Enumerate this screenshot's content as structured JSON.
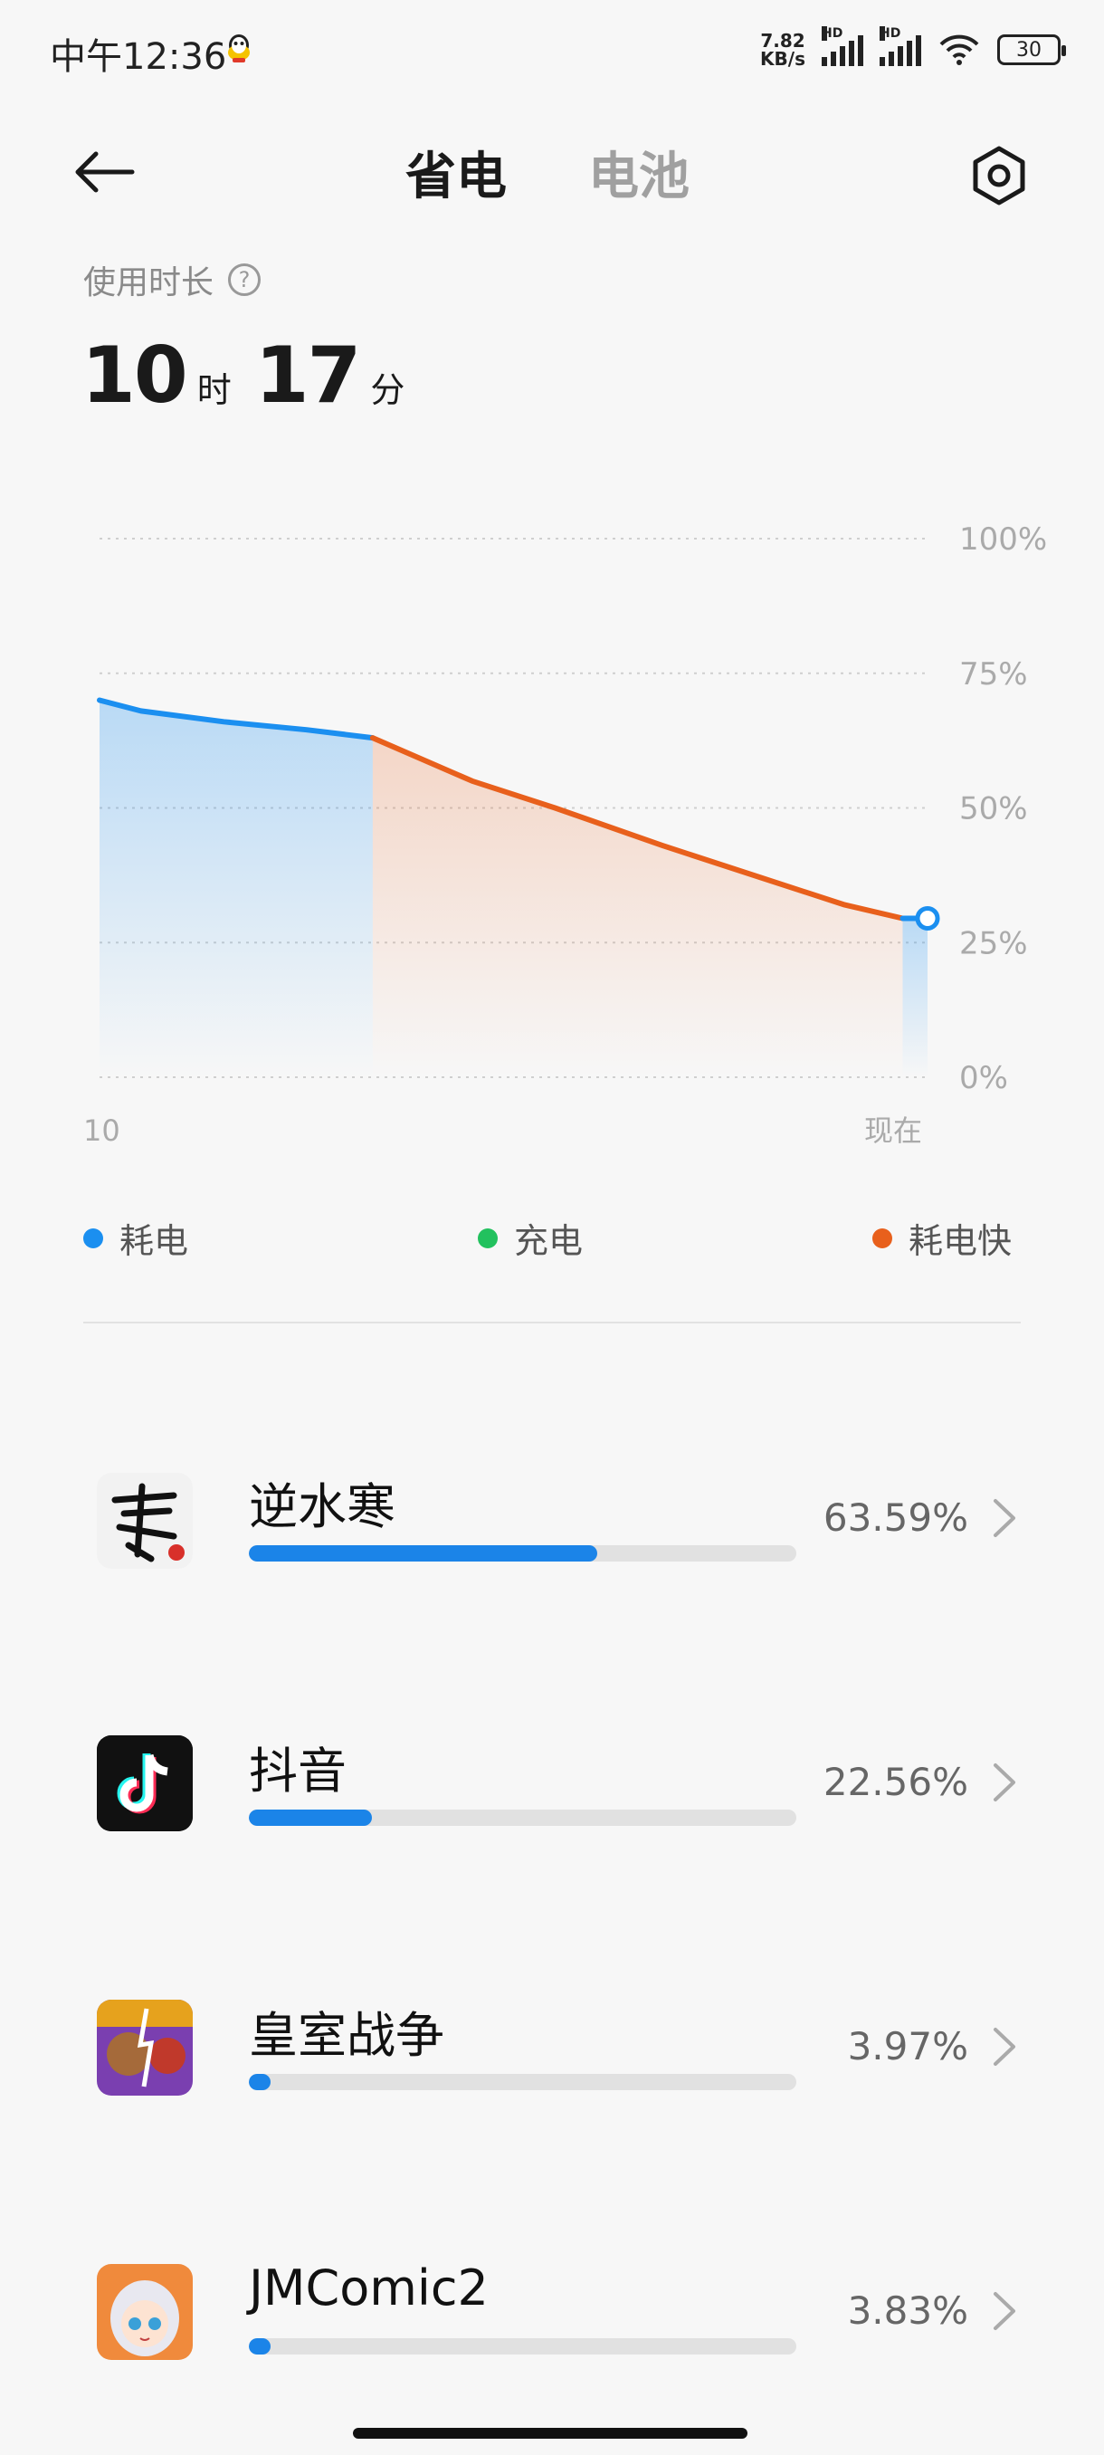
{
  "status": {
    "time": "中午12:36",
    "netspeed_top": "7.82",
    "netspeed_bottom": "KB/s",
    "hd_label_1": "HD",
    "hd_label_2": "HD",
    "battery": "30"
  },
  "header": {
    "tab_active": "省电",
    "tab_inactive": "电池"
  },
  "usage": {
    "label": "使用时长",
    "help": "?",
    "hours": "10",
    "hours_unit": "时",
    "minutes": "17",
    "minutes_unit": "分"
  },
  "chart_data": {
    "type": "area",
    "x_start_label": "10",
    "x_end_label": "现在",
    "y_ticks": [
      "100%",
      "75%",
      "50%",
      "25%",
      "0%"
    ],
    "ylim": [
      0,
      100
    ],
    "grid": true,
    "series": [
      {
        "name": "耗电",
        "color": "#1b8ff0",
        "points": [
          [
            0,
            70
          ],
          [
            0.05,
            68
          ],
          [
            0.15,
            66
          ],
          [
            0.25,
            64.5
          ],
          [
            0.33,
            63
          ]
        ]
      },
      {
        "name": "耗电快",
        "color": "#e8601c",
        "points": [
          [
            0.33,
            63
          ],
          [
            0.45,
            55
          ],
          [
            0.55,
            50
          ],
          [
            0.68,
            43
          ],
          [
            0.8,
            37
          ],
          [
            0.9,
            32
          ],
          [
            0.97,
            29.5
          ]
        ]
      },
      {
        "name": "耗电",
        "color": "#1b8ff0",
        "points": [
          [
            0.97,
            29.5
          ],
          [
            1.0,
            29.5
          ]
        ]
      }
    ]
  },
  "legend": [
    {
      "label": "耗电",
      "color": "#1b8ff0"
    },
    {
      "label": "充电",
      "color": "#22c15e"
    },
    {
      "label": "耗电快",
      "color": "#e8601c"
    }
  ],
  "apps": [
    {
      "name": "逆水寒",
      "percent": "63.59%",
      "fraction": 0.6359
    },
    {
      "name": "抖音",
      "percent": "22.56%",
      "fraction": 0.2256
    },
    {
      "name": "皇室战争",
      "percent": "3.97%",
      "fraction": 0.0397
    },
    {
      "name": "JMComic2",
      "percent": "3.83%",
      "fraction": 0.0383
    }
  ]
}
